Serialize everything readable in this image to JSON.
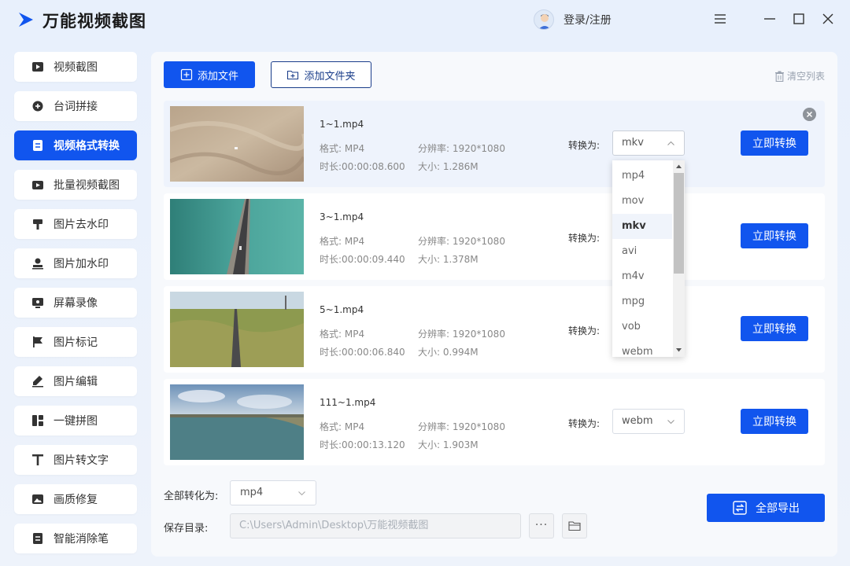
{
  "app": {
    "title": "万能视频截图",
    "login": "登录/注册"
  },
  "sidebar": {
    "items": [
      {
        "label": "视频截图",
        "icon": "video-frame-icon"
      },
      {
        "label": "台词拼接",
        "icon": "plus-circle-icon"
      },
      {
        "label": "视频格式转换",
        "icon": "convert-doc-icon",
        "active": true
      },
      {
        "label": "批量视频截图",
        "icon": "batch-video-icon"
      },
      {
        "label": "图片去水印",
        "icon": "brush-icon"
      },
      {
        "label": "图片加水印",
        "icon": "stamp-icon"
      },
      {
        "label": "屏幕录像",
        "icon": "screen-record-icon"
      },
      {
        "label": "图片标记",
        "icon": "flag-icon"
      },
      {
        "label": "图片编辑",
        "icon": "pen-icon"
      },
      {
        "label": "一键拼图",
        "icon": "grid-icon"
      },
      {
        "label": "图片转文字",
        "icon": "text-t-icon"
      },
      {
        "label": "画质修复",
        "icon": "image-icon"
      },
      {
        "label": "智能消除笔",
        "icon": "eraser-icon"
      }
    ]
  },
  "toolbar": {
    "add_file": "添加文件",
    "add_folder": "添加文件夹",
    "clear_list": "清空列表"
  },
  "labels": {
    "format": "格式:",
    "resolution": "分辨率:",
    "duration": "时长:",
    "size": "大小:",
    "convert_to": "转换为:",
    "convert_now": "立即转换"
  },
  "files": [
    {
      "name": "1~1.mp4",
      "format": "MP4",
      "resolution": "1920*1080",
      "duration": "00:00:08.600",
      "size": "1.286M",
      "target": "mkv"
    },
    {
      "name": "3~1.mp4",
      "format": "MP4",
      "resolution": "1920*1080",
      "duration": "00:00:09.440",
      "size": "1.378M",
      "target": ""
    },
    {
      "name": "5~1.mp4",
      "format": "MP4",
      "resolution": "1920*1080",
      "duration": "00:00:06.840",
      "size": "0.994M",
      "target": ""
    },
    {
      "name": "111~1.mp4",
      "format": "MP4",
      "resolution": "1920*1080",
      "duration": "00:00:13.120",
      "size": "1.903M",
      "target": "webm"
    }
  ],
  "dropdown": {
    "options": [
      "mp4",
      "mov",
      "mkv",
      "avi",
      "m4v",
      "mpg",
      "vob",
      "webm"
    ],
    "selected": "mkv"
  },
  "bottom": {
    "convert_all_label": "全部转化为:",
    "convert_all_value": "mp4",
    "save_dir_label": "保存目录:",
    "save_dir_value": "C:\\Users\\Admin\\Desktop\\万能视频截图",
    "more": "···",
    "export_all": "全部导出"
  },
  "colors": {
    "accent": "#1155ee",
    "bg": "#eef3fb"
  }
}
